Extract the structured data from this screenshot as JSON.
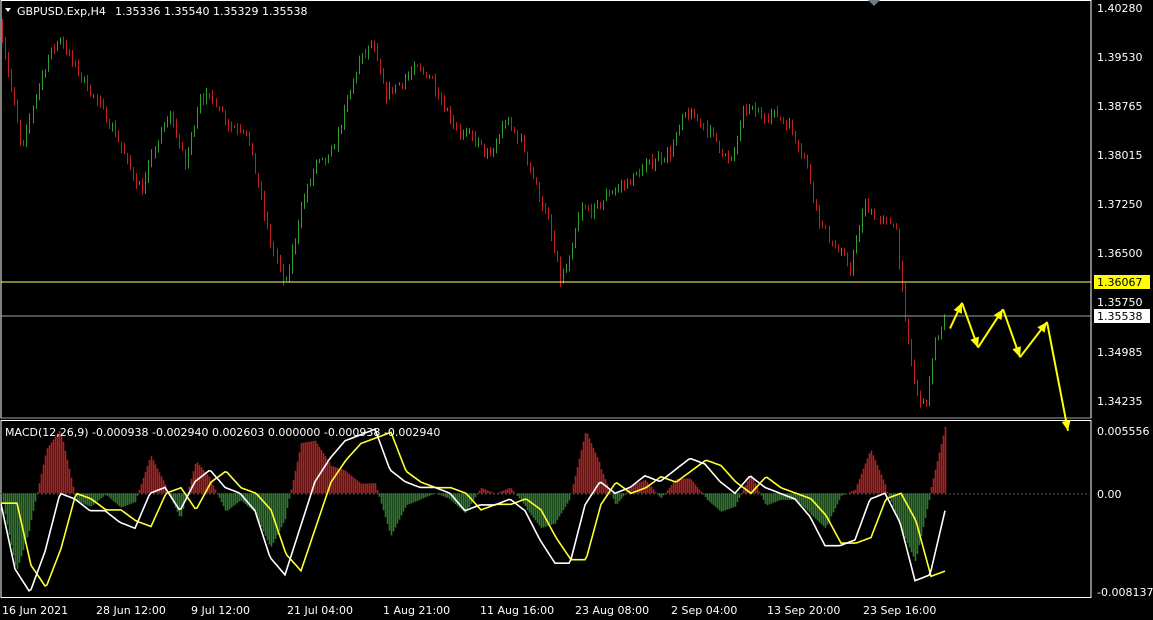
{
  "header": {
    "symbol_info": "GBPUSD.Exp,H4",
    "ohlc": "1.35336 1.35540 1.35329 1.35538"
  },
  "macd": {
    "label": "MACD(12,26,9) -0.000938 -0.002940 0.002603 0.000000 -0.000938 -0.002940",
    "axis_labels": [
      "0.005556",
      "0.00",
      "-0.008137"
    ]
  },
  "price_axis": {
    "labels": [
      "1.40280",
      "1.39530",
      "1.38765",
      "1.38015",
      "1.37250",
      "1.36500",
      "1.35750",
      "1.34985",
      "1.34235"
    ],
    "highlight_level": "1.36067",
    "current_price": "1.35538"
  },
  "time_axis": {
    "labels": [
      "16 Jun 2021",
      "28 Jun 12:00",
      "9 Jul 12:00",
      "21 Jul 04:00",
      "1 Aug 21:00",
      "11 Aug 16:00",
      "23 Aug 08:00",
      "2 Sep 04:00",
      "13 Sep 20:00",
      "23 Sep 16:00"
    ]
  },
  "colors": {
    "background": "#000000",
    "bull": "#2f9e2f",
    "bear": "#c02020",
    "level_line": "#ffff66",
    "arrow": "#ffff00",
    "macd_line": "#ffffff",
    "signal_line": "#ffff33",
    "hist_pos": "#b02020",
    "hist_neg": "#2a7a2a"
  },
  "chart_data": {
    "type": "candlestick",
    "price_range": [
      1.3395,
      1.4045
    ],
    "macd_range": [
      -0.0089,
      0.0062
    ],
    "price_path": [
      [
        0,
        1.401
      ],
      [
        10,
        1.392
      ],
      [
        22,
        1.381
      ],
      [
        35,
        1.39
      ],
      [
        48,
        1.396
      ],
      [
        60,
        1.399
      ],
      [
        72,
        1.395
      ],
      [
        85,
        1.392
      ],
      [
        100,
        1.388
      ],
      [
        115,
        1.384
      ],
      [
        128,
        1.379
      ],
      [
        142,
        1.375
      ],
      [
        155,
        1.382
      ],
      [
        170,
        1.387
      ],
      [
        185,
        1.379
      ],
      [
        200,
        1.39
      ],
      [
        215,
        1.389
      ],
      [
        230,
        1.385
      ],
      [
        245,
        1.385
      ],
      [
        258,
        1.376
      ],
      [
        270,
        1.367
      ],
      [
        285,
        1.36
      ],
      [
        300,
        1.372
      ],
      [
        315,
        1.379
      ],
      [
        330,
        1.38
      ],
      [
        345,
        1.388
      ],
      [
        358,
        1.395
      ],
      [
        372,
        1.398
      ],
      [
        385,
        1.39
      ],
      [
        400,
        1.392
      ],
      [
        415,
        1.394
      ],
      [
        430,
        1.393
      ],
      [
        445,
        1.388
      ],
      [
        460,
        1.384
      ],
      [
        475,
        1.383
      ],
      [
        490,
        1.38
      ],
      [
        505,
        1.386
      ],
      [
        520,
        1.383
      ],
      [
        535,
        1.376
      ],
      [
        548,
        1.37
      ],
      [
        560,
        1.361
      ],
      [
        570,
        1.364
      ],
      [
        580,
        1.372
      ],
      [
        595,
        1.372
      ],
      [
        610,
        1.375
      ],
      [
        625,
        1.376
      ],
      [
        640,
        1.378
      ],
      [
        655,
        1.38
      ],
      [
        670,
        1.381
      ],
      [
        685,
        1.387
      ],
      [
        700,
        1.386
      ],
      [
        715,
        1.383
      ],
      [
        730,
        1.379
      ],
      [
        745,
        1.388
      ],
      [
        760,
        1.387
      ],
      [
        775,
        1.387
      ],
      [
        790,
        1.385
      ],
      [
        805,
        1.38
      ],
      [
        820,
        1.37
      ],
      [
        835,
        1.366
      ],
      [
        850,
        1.363
      ],
      [
        865,
        1.373
      ],
      [
        880,
        1.37
      ],
      [
        895,
        1.37
      ],
      [
        905,
        1.354
      ],
      [
        915,
        1.344
      ],
      [
        925,
        1.341
      ],
      [
        935,
        1.351
      ],
      [
        945,
        1.355
      ]
    ],
    "macd_path": [
      [
        0,
        -0.0005
      ],
      [
        15,
        -0.0065
      ],
      [
        30,
        -0.0085
      ],
      [
        45,
        -0.005
      ],
      [
        60,
        0.0
      ],
      [
        75,
        -0.0005
      ],
      [
        90,
        -0.0015
      ],
      [
        105,
        -0.0015
      ],
      [
        120,
        -0.0025
      ],
      [
        135,
        -0.003
      ],
      [
        150,
        0.0
      ],
      [
        165,
        0.0005
      ],
      [
        180,
        -0.0015
      ],
      [
        195,
        0.001
      ],
      [
        210,
        0.002
      ],
      [
        225,
        0.0005
      ],
      [
        240,
        0.0
      ],
      [
        255,
        -0.0015
      ],
      [
        270,
        -0.0055
      ],
      [
        285,
        -0.007
      ],
      [
        300,
        -0.003
      ],
      [
        315,
        0.001
      ],
      [
        330,
        0.003
      ],
      [
        345,
        0.0045
      ],
      [
        360,
        0.005
      ],
      [
        375,
        0.0055
      ],
      [
        390,
        0.002
      ],
      [
        405,
        0.001
      ],
      [
        420,
        0.0005
      ],
      [
        435,
        0.0005
      ],
      [
        450,
        0.0
      ],
      [
        465,
        -0.0015
      ],
      [
        480,
        -0.001
      ],
      [
        495,
        -0.001
      ],
      [
        510,
        -0.0005
      ],
      [
        525,
        -0.0015
      ],
      [
        540,
        -0.004
      ],
      [
        555,
        -0.006
      ],
      [
        570,
        -0.006
      ],
      [
        585,
        -0.001
      ],
      [
        600,
        0.001
      ],
      [
        615,
        0.0
      ],
      [
        630,
        0.0005
      ],
      [
        645,
        0.0015
      ],
      [
        660,
        0.001
      ],
      [
        675,
        0.002
      ],
      [
        690,
        0.003
      ],
      [
        705,
        0.0025
      ],
      [
        720,
        0.001
      ],
      [
        735,
        0.0
      ],
      [
        750,
        0.0015
      ],
      [
        765,
        0.0005
      ],
      [
        780,
        0.0
      ],
      [
        795,
        -0.0005
      ],
      [
        810,
        -0.002
      ],
      [
        825,
        -0.0045
      ],
      [
        840,
        -0.0045
      ],
      [
        855,
        -0.004
      ],
      [
        870,
        -0.0005
      ],
      [
        885,
        0.0
      ],
      [
        900,
        -0.0025
      ],
      [
        915,
        -0.0075
      ],
      [
        930,
        -0.007
      ],
      [
        945,
        -0.0015
      ]
    ],
    "signal_lag": 16,
    "arrow_path": [
      [
        950,
        1.3535
      ],
      [
        962,
        1.3575
      ],
      [
        978,
        1.3505
      ],
      [
        1003,
        1.3565
      ],
      [
        1020,
        1.349
      ],
      [
        1047,
        1.3545
      ],
      [
        1068,
        1.3375
      ]
    ]
  }
}
